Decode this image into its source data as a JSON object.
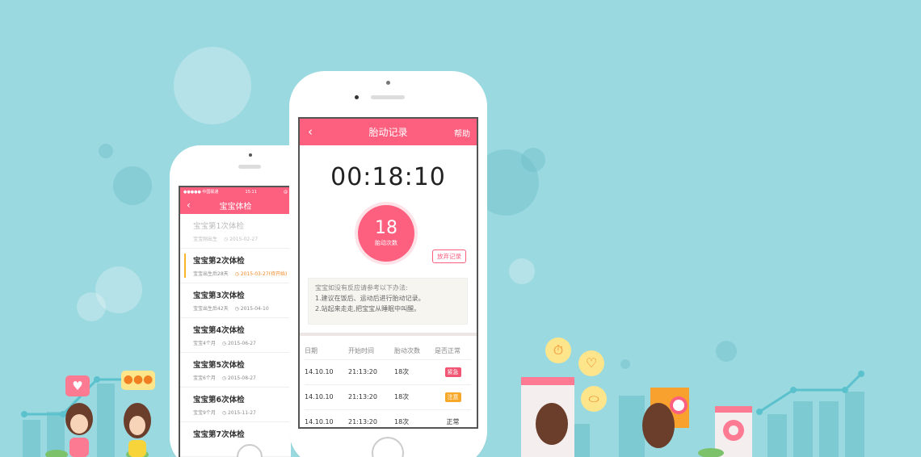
{
  "colors": {
    "accent": "#fd5f7f",
    "background": "#9bd9e0",
    "warning": "#f7b52a"
  },
  "small_phone": {
    "status_bar": {
      "carrier": "●●●●● 中国联通",
      "time": "15:11",
      "icon": "@"
    },
    "title": "宝宝体检",
    "back_icon": "chevron-left-icon",
    "checkups": [
      {
        "title": "宝宝第1次体检",
        "age": "宝宝刚出生",
        "date": "2015-02-27"
      },
      {
        "title": "宝宝第2次体检",
        "age": "宝宝出生后28天",
        "date": "2015-03-27(待开始)"
      },
      {
        "title": "宝宝第3次体检",
        "age": "宝宝出生后42天",
        "date": "2015-04-10"
      },
      {
        "title": "宝宝第4次体检",
        "age": "宝宝4个月",
        "date": "2015-06-27"
      },
      {
        "title": "宝宝第5次体检",
        "age": "宝宝6个月",
        "date": "2015-08-27"
      },
      {
        "title": "宝宝第6次体检",
        "age": "宝宝9个月",
        "date": "2015-11-27"
      },
      {
        "title": "宝宝第7次体检",
        "age": "",
        "date": ""
      }
    ]
  },
  "big_phone": {
    "title": "胎动记录",
    "back_icon": "chevron-left-icon",
    "help": "帮助",
    "timer": "00:18:10",
    "count": "18",
    "count_label": "胎动次数",
    "abandon": "放弃记录",
    "tips": {
      "heading": "宝宝如没有反应请参考以下办法:",
      "line1": "1.建议在饭后、运动后进行胎动记录。",
      "line2": "2.站起来走走,把宝宝从睡眠中叫醒。"
    },
    "table": {
      "headers": [
        "日期",
        "开始时间",
        "胎动次数",
        "是否正常"
      ],
      "rows": [
        {
          "date": "14.10.10",
          "time": "21:13:20",
          "count": "18次",
          "status": "紧急",
          "status_color": "#f05573"
        },
        {
          "date": "14.10.10",
          "time": "21:13:20",
          "count": "18次",
          "status": "注意",
          "status_color": "#f7a82a"
        },
        {
          "date": "14.10.10",
          "time": "21:13:20",
          "count": "18次",
          "status": "正常",
          "status_color": ""
        }
      ]
    }
  },
  "decorations": {
    "heart_bubble_icon": "heart-icon",
    "chat_bubble_icon": "ellipsis-icon",
    "stopwatch_icon": "stopwatch-icon",
    "heartbeat_icon": "heartbeat-icon",
    "pill_icon": "pill-icon"
  }
}
